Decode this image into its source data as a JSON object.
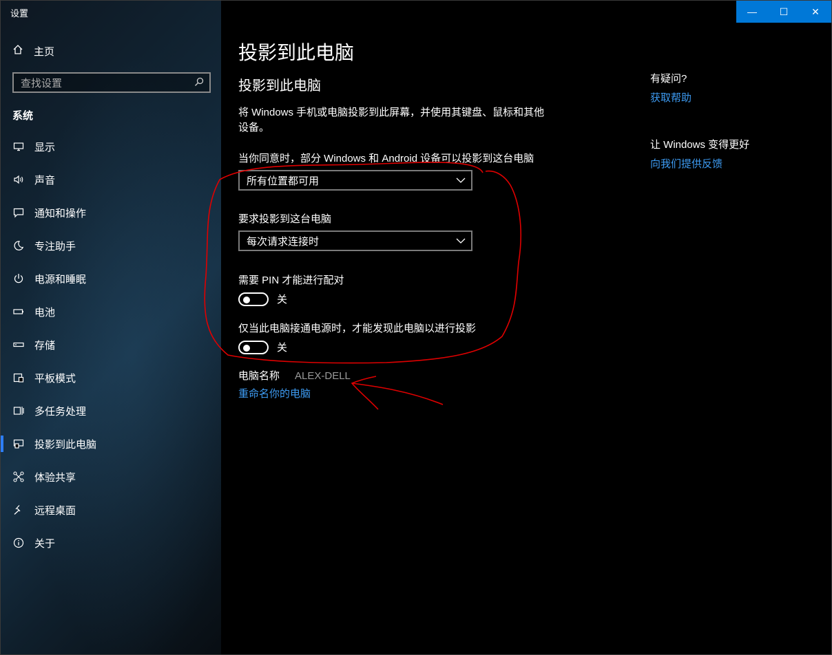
{
  "window": {
    "title": "设置",
    "controls": {
      "minimize": "—",
      "maximize": "☐",
      "close": "✕"
    }
  },
  "sidebar": {
    "home": {
      "icon": "home-icon",
      "label": "主页"
    },
    "search": {
      "placeholder": "查找设置",
      "icon": "search-icon"
    },
    "section": "系统",
    "items": [
      {
        "label": "显示",
        "icon": "display-icon"
      },
      {
        "label": "声音",
        "icon": "sound-icon"
      },
      {
        "label": "通知和操作",
        "icon": "notification-icon"
      },
      {
        "label": "专注助手",
        "icon": "moon-icon"
      },
      {
        "label": "电源和睡眠",
        "icon": "power-icon"
      },
      {
        "label": "电池",
        "icon": "battery-icon"
      },
      {
        "label": "存储",
        "icon": "storage-icon"
      },
      {
        "label": "平板模式",
        "icon": "tablet-icon"
      },
      {
        "label": "多任务处理",
        "icon": "multitask-icon"
      },
      {
        "label": "投影到此电脑",
        "icon": "projection-icon",
        "active": true
      },
      {
        "label": "体验共享",
        "icon": "share-icon"
      },
      {
        "label": "远程桌面",
        "icon": "remote-desktop-icon"
      },
      {
        "label": "关于",
        "icon": "info-icon"
      }
    ]
  },
  "main": {
    "title": "投影到此电脑",
    "subtitle": "投影到此电脑",
    "description": "将 Windows 手机或电脑投影到此屏幕，并使用其键盘、鼠标和其他设备。",
    "availability": {
      "label": "当你同意时，部分 Windows 和 Android 设备可以投影到这台电脑",
      "value": "所有位置都可用"
    },
    "ask_to_project": {
      "label": "要求投影到这台电脑",
      "value": "每次请求连接时"
    },
    "require_pin": {
      "label": "需要 PIN 才能进行配对",
      "state": "关"
    },
    "power_only": {
      "label": "仅当此电脑接通电源时，才能发现此电脑以进行投影",
      "state": "关"
    },
    "pc_name": {
      "label": "电脑名称",
      "value": "ALEX-DELL"
    },
    "rename_link": "重命名你的电脑"
  },
  "aside": {
    "question": "有疑问?",
    "help_link": "获取帮助",
    "improve": "让 Windows 变得更好",
    "feedback_link": "向我们提供反馈"
  },
  "colors": {
    "accent": "#0078d7",
    "link": "#3d9bf2",
    "annotation": "#e00000"
  }
}
